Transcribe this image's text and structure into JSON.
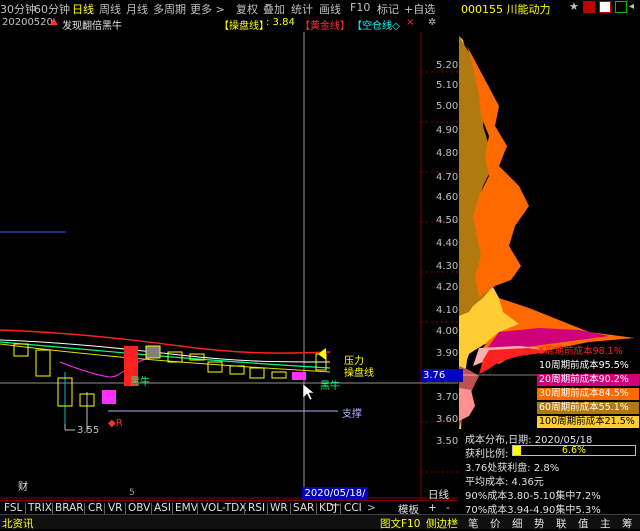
{
  "top_bar": {
    "tabs": [
      "30分钟",
      "60分钟",
      "日线",
      "周线",
      "月线",
      "多周期",
      "更多 >"
    ],
    "tools": [
      "复权",
      "叠加",
      "统计",
      "画线",
      "F10",
      "标记",
      "+自选"
    ],
    "active_tab": "日线"
  },
  "chart_header": {
    "date": "20200520",
    "formula_name": "发现翻倍黑牛",
    "op_line_label": "【操盘线】",
    "op_line_value": ": 3.84",
    "yellow_line_label": "【黄金线】",
    "empty_line_label": "【空仓线◇"
  },
  "stock": {
    "code_name": "000155 川能动力"
  },
  "annotations": {
    "pressure": "压力",
    "op_line": "操盘线",
    "black_bull_1": "黑牛",
    "black_bull_2": "黑牛",
    "support": "支撑",
    "low_value": "3.55",
    "r_mark": "◆R",
    "cai": "财",
    "axis_five": "5"
  },
  "price_axis": [
    "5.20",
    "5.10",
    "5.00",
    "4.90",
    "4.80",
    "4.70",
    "4.60",
    "4.50",
    "4.40",
    "4.30",
    "4.20",
    "4.10",
    "4.00",
    "3.90",
    "3.80",
    "3.70",
    "3.60",
    "3.50"
  ],
  "current_price": "3.76",
  "cost_legend": [
    {
      "text": "5周期前成本98.1%",
      "color": "#ff2020",
      "bg": "#000000"
    },
    {
      "text": "10周期前成本95.5%",
      "color": "#ffffff",
      "bg": "#000000"
    },
    {
      "text": "20周期前成本90.2%",
      "color": "#ffffff",
      "bg": "#d0007a"
    },
    {
      "text": "30周期前成本84.5%",
      "color": "#ffffff",
      "bg": "#ff6a00"
    },
    {
      "text": "60周期前成本55.1%",
      "color": "#ffffff",
      "bg": "#b07a10"
    },
    {
      "text": "100周期前成本21.5%",
      "color": "#000000",
      "bg": "#ffcc33"
    }
  ],
  "distribution": {
    "date_line": "成本分布,日期:  2020/05/18",
    "profit_label": "获利比例:",
    "profit_value": "6.6%",
    "profit_fraction": 0.066,
    "profit_at": "3.76处获利盘: 2.8%",
    "avg_cost": "平均成本: 4.36元",
    "cost90": "90%成本3.80-5.10集中7.2%",
    "cost70": "70%成本3.94-4.90集中5.3%"
  },
  "date_box": "2020/05/18/一",
  "indicator_tabs": [
    "FSL",
    "TRIX",
    "BRAR",
    "CR",
    "VR",
    "OBV",
    "ASI",
    "EMV",
    "VOL-TDX",
    "RSI",
    "WR",
    "SAR",
    "KDJ",
    "CCI"
  ],
  "indicator_tools": [
    "模板",
    "+",
    "-"
  ],
  "right_tab": "日线",
  "bottom_bar": {
    "left": "北资讯",
    "right_label": "图文F10",
    "sidebar": "侧边栏",
    "tabs": [
      "笔",
      "价",
      "细",
      "势",
      "联",
      "值",
      "主",
      "筹"
    ]
  },
  "colors": {
    "accent": "#ffff00",
    "axis_red": "#800000",
    "price_box": "#0000c0"
  }
}
